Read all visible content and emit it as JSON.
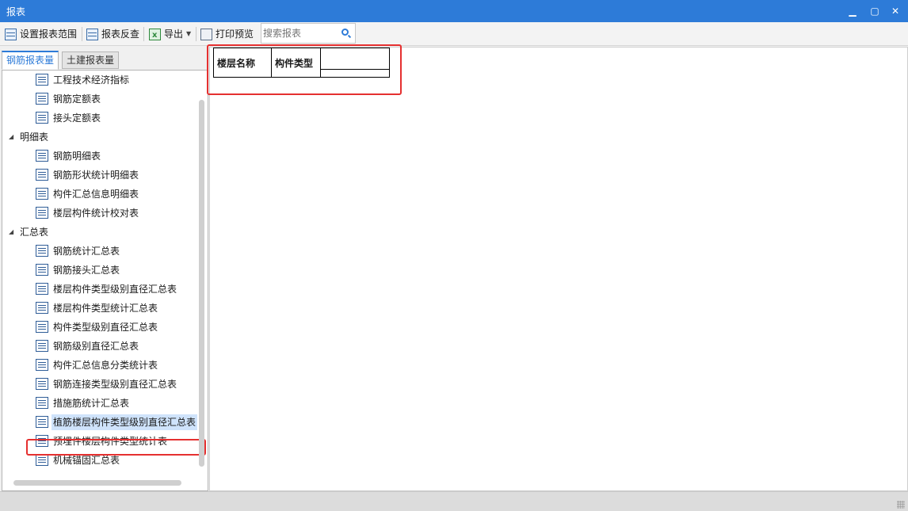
{
  "window": {
    "title": "报表",
    "minimize_glyph": "▁",
    "maximize_glyph": "▢",
    "close_glyph": "✕"
  },
  "toolbar": {
    "set_range_label": "设置报表范围",
    "reverse_check_label": "报表反查",
    "export_label": "导出",
    "print_preview_label": "打印预览",
    "search_placeholder": "搜索报表"
  },
  "tabs": [
    {
      "label": "钢筋报表量",
      "active": true
    },
    {
      "label": "土建报表量",
      "active": false
    }
  ],
  "tree": {
    "top_items": [
      "工程技术经济指标",
      "钢筋定额表",
      "接头定额表"
    ],
    "groups": [
      {
        "label": "明细表",
        "items": [
          "钢筋明细表",
          "钢筋形状统计明细表",
          "构件汇总信息明细表",
          "楼层构件统计校对表"
        ]
      },
      {
        "label": "汇总表",
        "items": [
          "钢筋统计汇总表",
          "钢筋接头汇总表",
          "楼层构件类型级别直径汇总表",
          "楼层构件类型统计汇总表",
          "构件类型级别直径汇总表",
          "钢筋级别直径汇总表",
          "构件汇总信息分类统计表",
          "钢筋连接类型级别直径汇总表",
          "措施筋统计汇总表",
          "植筋楼层构件类型级别直径汇总表",
          "预埋件楼层构件类型统计表",
          "机械锚固汇总表"
        ]
      }
    ],
    "selected": "植筋楼层构件类型级别直径汇总表"
  },
  "report": {
    "headers": [
      "楼层名称",
      "构件类型",
      ""
    ]
  },
  "colors": {
    "titlebar": "#2d7bd8",
    "highlight": "#e53030",
    "selected_bg": "#cfe3fb"
  },
  "icons": {
    "set_range": "grid-icon",
    "reverse_check": "table-search-icon",
    "export": "excel-icon",
    "print_preview": "print-preview-icon",
    "search": "search-icon",
    "report_item": "document-icon",
    "expand": "triangle-down-icon"
  }
}
